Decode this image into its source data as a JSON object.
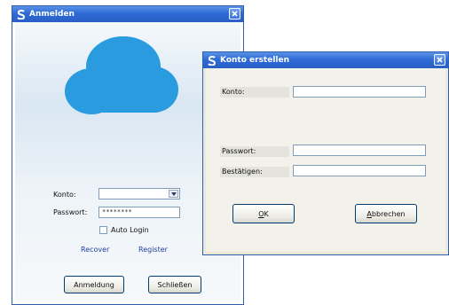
{
  "login": {
    "title": "Anmelden",
    "account_label": "Konto:",
    "account_value": "",
    "password_label": "Passwort:",
    "password_value": "********",
    "auto_login_label": "Auto Login",
    "recover_link": "Recover",
    "register_link": "Register",
    "login_button": "Anmeldung",
    "close_button": "Schließen"
  },
  "register": {
    "title": "Konto erstellen",
    "account_label": "Konto:",
    "account_value": "",
    "password_label": "Passwort:",
    "password_value": "",
    "confirm_label": "Bestätigen:",
    "confirm_value": "",
    "ok_button_rest": "K",
    "ok_button_mnemonic": "O",
    "cancel_button_rest": "bbrechen",
    "cancel_button_mnemonic": "A"
  },
  "colors": {
    "titlebar": "#2e6ad6",
    "cloud": "#2b9be0",
    "link": "#1f3f9a"
  },
  "icons": {
    "app": "s-logo-icon",
    "close": "close-icon",
    "dropdown": "chevron-down-icon"
  }
}
